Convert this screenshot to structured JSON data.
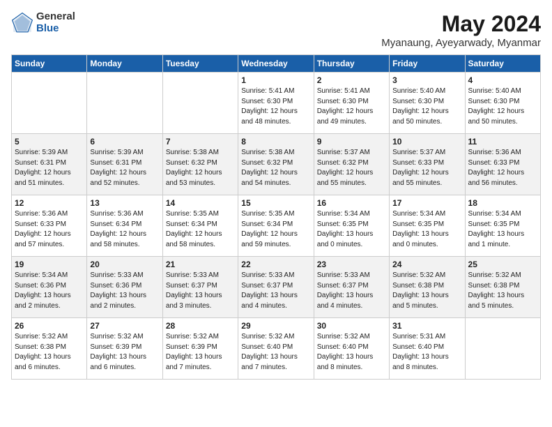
{
  "logo": {
    "general": "General",
    "blue": "Blue"
  },
  "title": "May 2024",
  "location": "Myanaung, Ayeyarwady, Myanmar",
  "days_header": [
    "Sunday",
    "Monday",
    "Tuesday",
    "Wednesday",
    "Thursday",
    "Friday",
    "Saturday"
  ],
  "weeks": [
    [
      {
        "day": "",
        "info": ""
      },
      {
        "day": "",
        "info": ""
      },
      {
        "day": "",
        "info": ""
      },
      {
        "day": "1",
        "info": "Sunrise: 5:41 AM\nSunset: 6:30 PM\nDaylight: 12 hours\nand 48 minutes."
      },
      {
        "day": "2",
        "info": "Sunrise: 5:41 AM\nSunset: 6:30 PM\nDaylight: 12 hours\nand 49 minutes."
      },
      {
        "day": "3",
        "info": "Sunrise: 5:40 AM\nSunset: 6:30 PM\nDaylight: 12 hours\nand 50 minutes."
      },
      {
        "day": "4",
        "info": "Sunrise: 5:40 AM\nSunset: 6:30 PM\nDaylight: 12 hours\nand 50 minutes."
      }
    ],
    [
      {
        "day": "5",
        "info": "Sunrise: 5:39 AM\nSunset: 6:31 PM\nDaylight: 12 hours\nand 51 minutes."
      },
      {
        "day": "6",
        "info": "Sunrise: 5:39 AM\nSunset: 6:31 PM\nDaylight: 12 hours\nand 52 minutes."
      },
      {
        "day": "7",
        "info": "Sunrise: 5:38 AM\nSunset: 6:32 PM\nDaylight: 12 hours\nand 53 minutes."
      },
      {
        "day": "8",
        "info": "Sunrise: 5:38 AM\nSunset: 6:32 PM\nDaylight: 12 hours\nand 54 minutes."
      },
      {
        "day": "9",
        "info": "Sunrise: 5:37 AM\nSunset: 6:32 PM\nDaylight: 12 hours\nand 55 minutes."
      },
      {
        "day": "10",
        "info": "Sunrise: 5:37 AM\nSunset: 6:33 PM\nDaylight: 12 hours\nand 55 minutes."
      },
      {
        "day": "11",
        "info": "Sunrise: 5:36 AM\nSunset: 6:33 PM\nDaylight: 12 hours\nand 56 minutes."
      }
    ],
    [
      {
        "day": "12",
        "info": "Sunrise: 5:36 AM\nSunset: 6:33 PM\nDaylight: 12 hours\nand 57 minutes."
      },
      {
        "day": "13",
        "info": "Sunrise: 5:36 AM\nSunset: 6:34 PM\nDaylight: 12 hours\nand 58 minutes."
      },
      {
        "day": "14",
        "info": "Sunrise: 5:35 AM\nSunset: 6:34 PM\nDaylight: 12 hours\nand 58 minutes."
      },
      {
        "day": "15",
        "info": "Sunrise: 5:35 AM\nSunset: 6:34 PM\nDaylight: 12 hours\nand 59 minutes."
      },
      {
        "day": "16",
        "info": "Sunrise: 5:34 AM\nSunset: 6:35 PM\nDaylight: 13 hours\nand 0 minutes."
      },
      {
        "day": "17",
        "info": "Sunrise: 5:34 AM\nSunset: 6:35 PM\nDaylight: 13 hours\nand 0 minutes."
      },
      {
        "day": "18",
        "info": "Sunrise: 5:34 AM\nSunset: 6:35 PM\nDaylight: 13 hours\nand 1 minute."
      }
    ],
    [
      {
        "day": "19",
        "info": "Sunrise: 5:34 AM\nSunset: 6:36 PM\nDaylight: 13 hours\nand 2 minutes."
      },
      {
        "day": "20",
        "info": "Sunrise: 5:33 AM\nSunset: 6:36 PM\nDaylight: 13 hours\nand 2 minutes."
      },
      {
        "day": "21",
        "info": "Sunrise: 5:33 AM\nSunset: 6:37 PM\nDaylight: 13 hours\nand 3 minutes."
      },
      {
        "day": "22",
        "info": "Sunrise: 5:33 AM\nSunset: 6:37 PM\nDaylight: 13 hours\nand 4 minutes."
      },
      {
        "day": "23",
        "info": "Sunrise: 5:33 AM\nSunset: 6:37 PM\nDaylight: 13 hours\nand 4 minutes."
      },
      {
        "day": "24",
        "info": "Sunrise: 5:32 AM\nSunset: 6:38 PM\nDaylight: 13 hours\nand 5 minutes."
      },
      {
        "day": "25",
        "info": "Sunrise: 5:32 AM\nSunset: 6:38 PM\nDaylight: 13 hours\nand 5 minutes."
      }
    ],
    [
      {
        "day": "26",
        "info": "Sunrise: 5:32 AM\nSunset: 6:38 PM\nDaylight: 13 hours\nand 6 minutes."
      },
      {
        "day": "27",
        "info": "Sunrise: 5:32 AM\nSunset: 6:39 PM\nDaylight: 13 hours\nand 6 minutes."
      },
      {
        "day": "28",
        "info": "Sunrise: 5:32 AM\nSunset: 6:39 PM\nDaylight: 13 hours\nand 7 minutes."
      },
      {
        "day": "29",
        "info": "Sunrise: 5:32 AM\nSunset: 6:40 PM\nDaylight: 13 hours\nand 7 minutes."
      },
      {
        "day": "30",
        "info": "Sunrise: 5:32 AM\nSunset: 6:40 PM\nDaylight: 13 hours\nand 8 minutes."
      },
      {
        "day": "31",
        "info": "Sunrise: 5:31 AM\nSunset: 6:40 PM\nDaylight: 13 hours\nand 8 minutes."
      },
      {
        "day": "",
        "info": ""
      }
    ]
  ]
}
